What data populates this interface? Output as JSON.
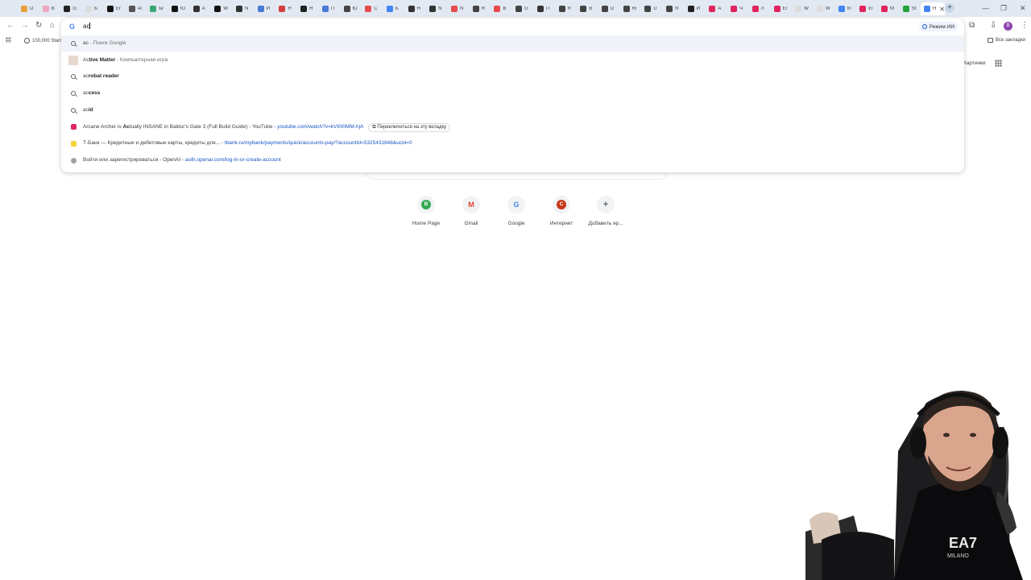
{
  "tabs": [
    {
      "label": "D",
      "color": "#e7a13a"
    },
    {
      "label": "B",
      "color": "#f1a7c1"
    },
    {
      "label": "G",
      "color": "#222222"
    },
    {
      "label": "Б",
      "color": "#dddddd"
    },
    {
      "label": "Er",
      "color": "#111111"
    },
    {
      "label": "Al",
      "color": "#555555"
    },
    {
      "label": "Бг",
      "color": "#3aa876"
    },
    {
      "label": "Ю",
      "color": "#111111"
    },
    {
      "label": "A",
      "color": "#333333"
    },
    {
      "label": "W",
      "color": "#111111"
    },
    {
      "label": "N",
      "color": "#333333"
    },
    {
      "label": "И",
      "color": "#4a7bd4"
    },
    {
      "label": "Н",
      "color": "#d33f3f"
    },
    {
      "label": "Н",
      "color": "#222222"
    },
    {
      "label": "П",
      "color": "#4a7bd4"
    },
    {
      "label": "Ю",
      "color": "#444444"
    },
    {
      "label": "С",
      "color": "#e54b4b"
    },
    {
      "label": "Б",
      "color": "#4285f4"
    },
    {
      "label": "Н",
      "color": "#333333"
    },
    {
      "label": "N",
      "color": "#333333"
    },
    {
      "label": "N",
      "color": "#e54b4b"
    },
    {
      "label": "R",
      "color": "#444444"
    },
    {
      "label": "В",
      "color": "#e54b4b"
    },
    {
      "label": "G",
      "color": "#444444"
    },
    {
      "label": "П",
      "color": "#333333"
    },
    {
      "label": "R",
      "color": "#444444"
    },
    {
      "label": "В",
      "color": "#444444"
    },
    {
      "label": "D",
      "color": "#444444"
    },
    {
      "label": "Ri",
      "color": "#444444"
    },
    {
      "label": "U",
      "color": "#444444"
    },
    {
      "label": "Я",
      "color": "#444444"
    },
    {
      "label": "И",
      "color": "#222222"
    },
    {
      "label": "А",
      "color": "#e0245e"
    },
    {
      "label": "Ч",
      "color": "#e0245e"
    },
    {
      "label": "Л",
      "color": "#e0245e"
    },
    {
      "label": "El",
      "color": "#e0245e"
    },
    {
      "label": "W",
      "color": "#dddddd"
    },
    {
      "label": "W",
      "color": "#dddddd"
    },
    {
      "label": "In",
      "color": "#4285f4"
    },
    {
      "label": "El",
      "color": "#e0245e"
    },
    {
      "label": "M",
      "color": "#e0245e"
    },
    {
      "label": "St",
      "color": "#23a23a"
    },
    {
      "label": "Н",
      "color": "#4285f4"
    }
  ],
  "active_tab": {
    "label": "Н",
    "close": "✕"
  },
  "new_tab_symbol": "+",
  "window": {
    "min": "—",
    "max": "❐",
    "close": "✕"
  },
  "bookmarks": {
    "first": "100,000 Stars",
    "all": "Все закладки"
  },
  "omnibox": {
    "value": "ac",
    "ai_mode": "Режим ИИ",
    "suggestions": [
      {
        "type": "search",
        "pre": "ac",
        "bold": "",
        "post": "",
        "desc": " - Поиск Google",
        "url": "",
        "switch": ""
      },
      {
        "type": "entity",
        "pre": "Ac",
        "bold": "tive Matter",
        "post": "",
        "desc": " - Компьютерная игра",
        "url": "",
        "switch": ""
      },
      {
        "type": "search",
        "pre": "ac",
        "bold": "robat reader",
        "post": "",
        "desc": "",
        "url": "",
        "switch": ""
      },
      {
        "type": "search",
        "pre": "ac",
        "bold": "cess",
        "post": "",
        "desc": "",
        "url": "",
        "switch": ""
      },
      {
        "type": "search",
        "pre": "ac",
        "bold": "id",
        "post": "",
        "desc": "",
        "url": "",
        "switch": ""
      },
      {
        "type": "youtube",
        "pre": "Arcane Archer is ",
        "bold": "Ac",
        "post": "tually INSANE in Baldur's Gate 3 (Full Build Guide) - YouTube",
        "desc": "",
        "url": " - youtube.com/watch?v=kVl0I0MM-hjA",
        "switch": "Переключиться на эту вкладку"
      },
      {
        "type": "tbank",
        "pre": "Т-Банк — Кредитные и дебетовые карты, кредиты для...",
        "bold": "",
        "post": "",
        "desc": "",
        "url": " - tbank.ru/mybank/payments/quick/accounts-pay/?accountId=5325431848&ucid=0",
        "switch": ""
      },
      {
        "type": "site",
        "pre": "Войти или зарегистрироваться - OpenAI",
        "bold": "",
        "post": "",
        "desc": "",
        "url": " - auth.openai.com/log-in-or-create-account",
        "switch": ""
      }
    ]
  },
  "header_right": {
    "images": "Картинки"
  },
  "shortcuts": [
    {
      "label": "Home Page",
      "letter": "B",
      "color": "#34a853"
    },
    {
      "label": "Gmail",
      "letter": "M",
      "color": "#ea4335"
    },
    {
      "label": "Google",
      "letter": "G",
      "color": "#4285f4"
    },
    {
      "label": "Интернет",
      "letter": "C",
      "color": "#c5391c"
    },
    {
      "label": "Добавить яр...",
      "letter": "+",
      "color": "#5f6368"
    }
  ],
  "webcam": {
    "shirt_text": "EA7 MILANO"
  }
}
